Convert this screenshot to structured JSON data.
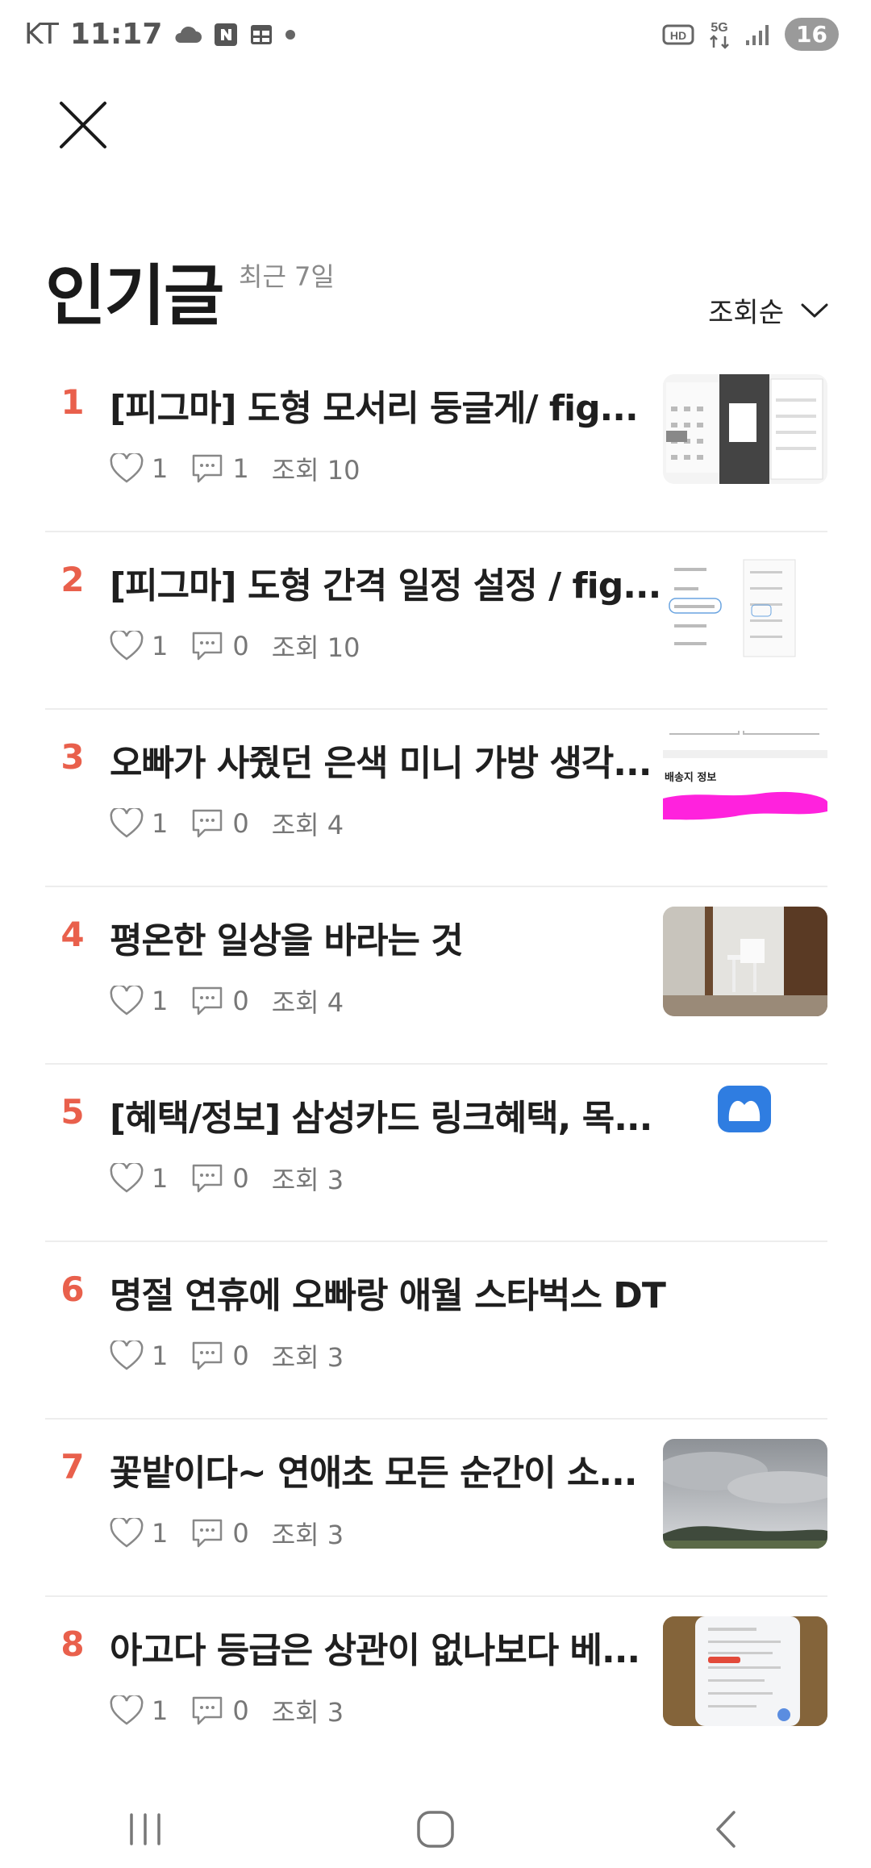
{
  "status_bar": {
    "carrier": "KT",
    "time": "11:17",
    "battery": "16",
    "network": "5G"
  },
  "header": {
    "title": "인기글",
    "subtitle": "최근 7일",
    "sort_label": "조회순"
  },
  "posts": [
    {
      "rank": "1",
      "title": "[피그마] 도형 모서리 둥글게/ fig...",
      "likes": "1",
      "comments": "1",
      "views": "조회 10",
      "thumb": "figma-calendar"
    },
    {
      "rank": "2",
      "title": "[피그마] 도형 간격 일정 설정 / fig...",
      "likes": "1",
      "comments": "0",
      "views": "조회 10",
      "thumb": "figma-menu"
    },
    {
      "rank": "3",
      "title": "오빠가 사줬던 은색 미니 가방 생각...",
      "likes": "1",
      "comments": "0",
      "views": "조회 4",
      "thumb": "shipping-form",
      "thumb_text": "배송지 정보"
    },
    {
      "rank": "4",
      "title": "평온한 일상을 바라는 것",
      "likes": "1",
      "comments": "0",
      "views": "조회 4",
      "thumb": "room-photo"
    },
    {
      "rank": "5",
      "title": "[혜택/정보] 삼성카드 링크혜택, 목...",
      "likes": "1",
      "comments": "0",
      "views": "조회 3",
      "thumb": "app-logo"
    },
    {
      "rank": "6",
      "title": "명절 연휴에 오빠랑 애월 스타벅스 DT",
      "likes": "1",
      "comments": "0",
      "views": "조회 3",
      "thumb": ""
    },
    {
      "rank": "7",
      "title": "꽃밭이다~ 연애초 모든 순간이 소...",
      "likes": "1",
      "comments": "0",
      "views": "조회 3",
      "thumb": "cloudy-sky"
    },
    {
      "rank": "8",
      "title": "아고다 등급은 상관이 없나보다 베...",
      "likes": "1",
      "comments": "0",
      "views": "조회 3",
      "thumb": "phone-photo"
    }
  ],
  "colors": {
    "rank": "#e9604c",
    "divider": "#ededed",
    "meta": "#777777"
  }
}
